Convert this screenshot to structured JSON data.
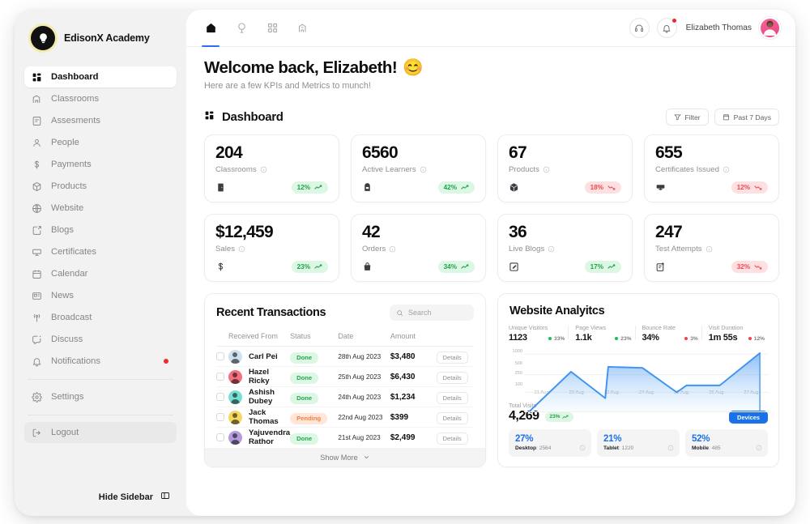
{
  "brand": {
    "name": "EdisonX Academy",
    "logo_icon": "lightbulb-icon"
  },
  "sidebar": {
    "items": [
      {
        "label": "Dashboard",
        "icon": "grid-icon",
        "active": true
      },
      {
        "label": "Classrooms",
        "icon": "classroom-icon",
        "active": false
      },
      {
        "label": "Assesments",
        "icon": "assessment-icon",
        "active": false
      },
      {
        "label": "People",
        "icon": "person-icon",
        "active": false
      },
      {
        "label": "Payments",
        "icon": "dollar-icon",
        "active": false
      },
      {
        "label": "Products",
        "icon": "box-icon",
        "active": false
      },
      {
        "label": "Website",
        "icon": "globe-icon",
        "active": false
      },
      {
        "label": "Blogs",
        "icon": "edit-square-icon",
        "active": false
      },
      {
        "label": "Certificates",
        "icon": "certificate-icon",
        "active": false
      },
      {
        "label": "Calendar",
        "icon": "calendar-icon",
        "active": false
      },
      {
        "label": "News",
        "icon": "news-icon",
        "active": false
      },
      {
        "label": "Broadcast",
        "icon": "broadcast-icon",
        "active": false
      },
      {
        "label": "Discuss",
        "icon": "chat-icon",
        "active": false
      },
      {
        "label": "Notifications",
        "icon": "bell-icon",
        "active": false,
        "dot": true
      }
    ],
    "settings": {
      "label": "Settings",
      "icon": "gear-icon"
    },
    "logout": {
      "label": "Logout",
      "icon": "logout-icon"
    },
    "hide_sidebar": {
      "label": "Hide Sidebar",
      "icon": "panel-collapse-icon"
    },
    "notification_dot_color": "#ef2b2b"
  },
  "topbar": {
    "nav": [
      {
        "name": "home",
        "icon": "home-icon",
        "active": true
      },
      {
        "name": "explore",
        "icon": "compass-icon",
        "active": false
      },
      {
        "name": "apps",
        "icon": "apps-grid-icon",
        "active": false
      },
      {
        "name": "reports",
        "icon": "reports-icon",
        "active": false
      }
    ],
    "support_icon": "headset-icon",
    "notifications_icon": "bell-icon",
    "user_name": "Elizabeth Thomas",
    "avatar_alt": "avatar"
  },
  "welcome": {
    "title": "Welcome back, Elizabeth!",
    "emoji": "😊",
    "subtitle": "Here are a few KPIs and Metrics to munch!"
  },
  "section": {
    "title": "Dashboard",
    "title_icon": "grid-icon",
    "filter_label": "Filter",
    "filter_icon": "funnel-icon",
    "range_label": "Past 7 Days",
    "range_icon": "calendar-icon"
  },
  "kpis": [
    {
      "value": "204",
      "label": "Classrooms",
      "icon": "door-icon",
      "delta": "12%",
      "dir": "up"
    },
    {
      "value": "6560",
      "label": "Active Learners",
      "icon": "backpack-icon",
      "delta": "42%",
      "dir": "up"
    },
    {
      "value": "67",
      "label": "Products",
      "icon": "box-3d-icon",
      "delta": "18%",
      "dir": "down"
    },
    {
      "value": "655",
      "label": "Certificates Issued",
      "icon": "certificate-icon",
      "delta": "12%",
      "dir": "down"
    },
    {
      "value": "$12,459",
      "label": "Sales",
      "icon": "dollar-icon",
      "delta": "23%",
      "dir": "up"
    },
    {
      "value": "42",
      "label": "Orders",
      "icon": "bag-icon",
      "delta": "34%",
      "dir": "up"
    },
    {
      "value": "36",
      "label": "Live Blogs",
      "icon": "edit-square-icon",
      "delta": "17%",
      "dir": "up"
    },
    {
      "value": "247",
      "label": "Test Attempts",
      "icon": "test-sheet-icon",
      "delta": "32%",
      "dir": "down"
    }
  ],
  "transactions": {
    "title": "Recent Transactions",
    "search_placeholder": "Search",
    "search_value": "",
    "search_icon": "search-icon",
    "columns": [
      "Received From",
      "Status",
      "Date",
      "Amount"
    ],
    "details_label": "Details",
    "rows": [
      {
        "name": "Carl Pei",
        "status": "Done",
        "date": "28th Aug 2023",
        "amount": "$3,480",
        "avatar_color": "#cfe0ef"
      },
      {
        "name": "Hazel Ricky",
        "status": "Done",
        "date": "25th Aug 2023",
        "amount": "$6,430",
        "avatar_color": "#f4707f"
      },
      {
        "name": "Ashish Dubey",
        "status": "Done",
        "date": "24th Aug 2023",
        "amount": "$1,234",
        "avatar_color": "#77dfd3"
      },
      {
        "name": "Jack Thomas",
        "status": "Pending",
        "date": "22nd Aug 2023",
        "amount": "$399",
        "avatar_color": "#f6d861"
      },
      {
        "name": "Yajuvendra Rathor",
        "status": "Done",
        "date": "21st Aug 2023",
        "amount": "$2,499",
        "avatar_color": "#b79bdf"
      }
    ],
    "show_more_label": "Show More",
    "show_more_icon": "chevron-down-icon"
  },
  "analytics": {
    "title": "Website Analyitcs",
    "metrics": [
      {
        "key": "Unique Visitors",
        "value": "1123",
        "delta": "33%",
        "dir": "up"
      },
      {
        "key": "Page Views",
        "value": "1.1k",
        "delta": "23%",
        "dir": "up"
      },
      {
        "key": "Bounce Rate",
        "value": "34%",
        "delta": "3%",
        "dir": "down"
      },
      {
        "key": "Visit Duration",
        "value": "1m 55s",
        "delta": "12%",
        "dir": "down"
      }
    ],
    "total_visits_label": "Total Visits",
    "total_visits_value": "4,269",
    "total_visits_delta": "23%",
    "devices_button": "Devices",
    "devices": [
      {
        "pct": "27%",
        "name": "Desktop",
        "count": "2564"
      },
      {
        "pct": "21%",
        "name": "Tablet",
        "count": "1220"
      },
      {
        "pct": "52%",
        "name": "Mobile",
        "count": "485"
      }
    ],
    "accent_color": "#1b72e8"
  },
  "chart_data": {
    "type": "area",
    "title": "Website Analyitcs",
    "xlabel": "",
    "ylabel": "",
    "x": [
      "21 Aug",
      "22 Aug",
      "23 Aug",
      "24 Aug",
      "25 Aug",
      "26 Aug",
      "27 Aug"
    ],
    "ytick_labels": [
      "100",
      "250",
      "500",
      "1000"
    ],
    "ylim": [
      100,
      1000
    ],
    "grid": false,
    "legend": "none",
    "series": [
      {
        "name": "Visits",
        "values": [
          100,
          500,
          190,
          560,
          230,
          330,
          1050
        ]
      }
    ],
    "points": [
      {
        "x": "21 Aug",
        "y": 100
      },
      {
        "x": "21.5 Aug",
        "y": 300
      },
      {
        "x": "22 Aug",
        "y": 500
      },
      {
        "x": "23 Aug",
        "y": 190
      },
      {
        "x": "23.1 Aug",
        "y": 560
      },
      {
        "x": "24 Aug",
        "y": 555
      },
      {
        "x": "25 Aug",
        "y": 230
      },
      {
        "x": "25.5 Aug",
        "y": 330
      },
      {
        "x": "26 Aug",
        "y": 330
      },
      {
        "x": "27 Aug",
        "y": 1050
      }
    ]
  }
}
